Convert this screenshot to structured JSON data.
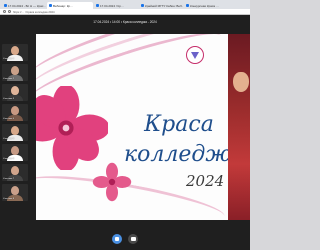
{
  "browser": {
    "tabs": [
      {
        "label": "17.04.2024 - Вс Н — Крас…",
        "active": false
      },
      {
        "label": "Вебинар: Кр…",
        "active": true
      },
      {
        "label": "17.04.2024 / Кр…",
        "active": false
      },
      {
        "label": "Крайний МГТУ Кабин: Веб Ли…",
        "active": false
      },
      {
        "label": "Конкурсная Краса …",
        "active": false
      }
    ],
    "url": "https://… / Краса колледжа 2024"
  },
  "meeting": {
    "title": "17.04.2024 • 14:00 • Краса колледжа - 2024"
  },
  "participants": [
    {
      "name": "Участник 1",
      "skin": "#d9a98b",
      "shirt": "#f2f2f2"
    },
    {
      "name": "Участник 2",
      "skin": "#caa189",
      "shirt": "#6e6e6e"
    },
    {
      "name": "Участник 3",
      "skin": "#e0b59a",
      "shirt": "#3b3b3b"
    },
    {
      "name": "Участник 4",
      "skin": "#c99982",
      "shirt": "#7a5a4a"
    },
    {
      "name": "Участник 5",
      "skin": "#d7a88a",
      "shirt": "#ebebeb"
    },
    {
      "name": "Участник 6",
      "skin": "#c79b86",
      "shirt": "#ffffff"
    },
    {
      "name": "Участник 7",
      "skin": "#d2a58c",
      "shirt": "#454545"
    },
    {
      "name": "Участник 8",
      "skin": "#caa08a",
      "shirt": "#8a6a55"
    }
  ],
  "slide": {
    "title_line1": "Краса",
    "title_line2": "колледжа",
    "year": "2024"
  },
  "colors": {
    "accent": "#4a90e2",
    "slide_title": "#1f4e8c",
    "flower": "#e1417e",
    "app_bg": "#1f1f1f"
  },
  "controls": [
    {
      "icon": "microphone-icon"
    },
    {
      "icon": "camera-icon"
    }
  ]
}
